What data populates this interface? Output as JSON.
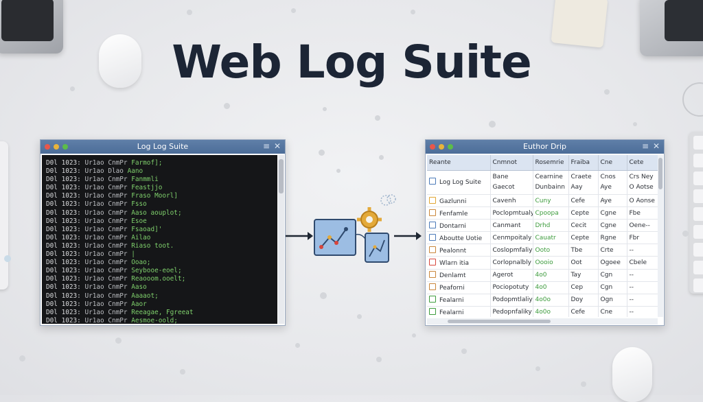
{
  "app": {
    "title": "Web Log Suite"
  },
  "terminal": {
    "title": "Log Log Suite",
    "lines": [
      {
        "a": "D0l 1023:",
        "b": "Ur1ao CnmPr",
        "c": "Farmof];"
      },
      {
        "a": "D0l 1023:",
        "b": "Ur1ao Dlao",
        "c": "Aano"
      },
      {
        "a": "D0l 1023:",
        "b": "Ur1ao CnmPr",
        "c": "Fanmmli"
      },
      {
        "a": "D0l 1023:",
        "b": "Ur1ao CnmPr",
        "c": "Feastjjo"
      },
      {
        "a": "D0l 1023:",
        "b": "Ur1ao CnmPr",
        "c": "Fraso Moorl]"
      },
      {
        "a": "D0l 1023:",
        "b": "Ur1ao CnmPr",
        "c": "Fsso"
      },
      {
        "a": "D0l 1023:",
        "b": "Ur1ao CnmPr",
        "c": "Aaso aouplot;"
      },
      {
        "a": "D0l 1023:",
        "b": "Ur1ao CnmPr",
        "c": "Esoe"
      },
      {
        "a": "D0l 1023:",
        "b": "Ur1ao CnmPr",
        "c": "Fsaoad]'"
      },
      {
        "a": "D0l 1023:",
        "b": "Ur1ao CnmPr",
        "c": "Ailao"
      },
      {
        "a": "D0l 1023:",
        "b": "Ur1ao CnmPr",
        "c": "Riaso toot."
      },
      {
        "a": "D0l 1023:",
        "b": "Ur1ao CnmPr",
        "c": "|"
      },
      {
        "a": "D0l 1023:",
        "b": "Ur1ao CnmPr",
        "c": "Ooao;"
      },
      {
        "a": "D0l 1023:",
        "b": "Ur1ao CnmPr",
        "c": "Seybooe-eoel;"
      },
      {
        "a": "D0l 1023:",
        "b": "Ur1ao CnmPr",
        "c": "Reaooom.ooelt;"
      },
      {
        "a": "D0l 1023:",
        "b": "Ur1ao CnmPr",
        "c": "Aaso"
      },
      {
        "a": "D0l 1023:",
        "b": "Ur1ao CnmPr",
        "c": "Aaaaot;"
      },
      {
        "a": "D0l 1023:",
        "b": "Ur1ao CnmPr",
        "c": "Aaor"
      },
      {
        "a": "D0l 1023:",
        "b": "Ur1ao CnmPr",
        "c": "Reeagae, Fgreeat"
      },
      {
        "a": "D0l 1023:",
        "b": "Ur1ao CnmPr",
        "c": "Aesmoe-oold;"
      }
    ]
  },
  "table_window": {
    "title": "Euthor Drip",
    "columns": [
      "Reante",
      "Cnmnot",
      "Rosemrie",
      "Fraiba",
      "Cne",
      "Cete"
    ],
    "rows": [
      {
        "name": "Log Log Suite",
        "sub": "",
        "c1": "Bane Gaecot",
        "c2": "Cearnine Dunbainn",
        "c3": "Craete Aay",
        "c4": "Cnos Aye",
        "c5": "Crs Ney O Aotse"
      },
      {
        "name": "Gazlunni",
        "c1": "Cavenh",
        "c2": "Cuny",
        "c3": "Cefe",
        "c4": "Aye",
        "c5": "O Aonse"
      },
      {
        "name": "Fenfamle",
        "c1": "Poclopmtualy",
        "c2": "Cpoopa",
        "c3": "Cepte",
        "c4": "Cgne",
        "c5": "Fbe"
      },
      {
        "name": "Dontarni",
        "c1": "Canmant",
        "c2": "Drhd",
        "c3": "Cecit",
        "c4": "Cgne",
        "c5": "Oene--"
      },
      {
        "name": "Aboutte Uotie",
        "c1": "Cenmpoitaly",
        "c2": "Cauatr",
        "c3": "Cepte",
        "c4": "Rgne",
        "c5": "Fbr"
      },
      {
        "name": "Pealonnt",
        "c1": "Coslopmfaliy",
        "c2": "Ooto",
        "c3": "Tbe",
        "c4": "Crte",
        "c5": "--"
      },
      {
        "name": "Wlarn itia",
        "c1": "Corlopnalbly",
        "c2": "Oooio",
        "c3": "Oot",
        "c4": "Ogoee",
        "c5": "Cbele"
      },
      {
        "name": "Denlamt",
        "c1": "Agerot",
        "c2": "4o0",
        "c3": "Tay",
        "c4": "Cgn",
        "c5": "--"
      },
      {
        "name": "Peaforni",
        "c1": "Pociopotuty",
        "c2": "4o0",
        "c3": "Cep",
        "c4": "Cgn",
        "c5": "--"
      },
      {
        "name": "Fealarni",
        "c1": "Podopmtlaliy",
        "c2": "4o0o",
        "c3": "Doy",
        "c4": "Ogn",
        "c5": "--"
      },
      {
        "name": "Fealarni",
        "c1": "Pedopnfaliky",
        "c2": "4o0o",
        "c3": "Cefe",
        "c4": "Cne",
        "c5": "--"
      }
    ]
  },
  "colors": {
    "title_text": "#1c2535",
    "titlebar": "#4c6d98",
    "terminal_bg": "#151618",
    "terminal_green": "#7fd06c",
    "header_bg": "#dbe4f1",
    "arrow": "#1f2733",
    "gear": "#e3a93a",
    "flow_box": "#8fb3de"
  },
  "icons": [
    "folder-icon",
    "gear-icon",
    "cloud-icon",
    "arrow-right-icon"
  ]
}
